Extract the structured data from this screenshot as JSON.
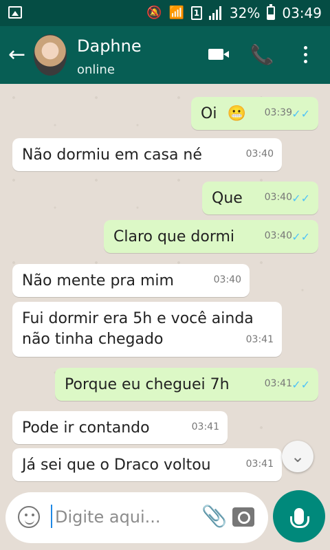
{
  "status_bar": {
    "icons": [
      "gallery-icon",
      "mute-icon",
      "wifi-icon",
      "sim-icon",
      "signal-icon"
    ],
    "sim_label": "1",
    "battery": "32%",
    "time": "03:49"
  },
  "header": {
    "contact_name": "Daphne",
    "contact_status": "online"
  },
  "messages": [
    {
      "dir": "out",
      "text": "Oi",
      "emoji": "😬",
      "time": "03:39",
      "read": true
    },
    {
      "dir": "in",
      "text": "Não dormiu em casa né",
      "time": "03:40"
    },
    {
      "dir": "out",
      "text": "Que",
      "time": "03:40",
      "read": true
    },
    {
      "dir": "out",
      "text": "Claro que dormi",
      "time": "03:40",
      "read": true
    },
    {
      "dir": "in",
      "text": "Não mente pra mim",
      "time": "03:40"
    },
    {
      "dir": "in",
      "text_lines": [
        "Fui dormir era 5h e você ainda",
        "não tinha chegado"
      ],
      "time": "03:41"
    },
    {
      "dir": "out",
      "text": "Porque eu cheguei 7h",
      "time": "03:41",
      "read": true
    },
    {
      "dir": "in",
      "text": "Pode ir contando",
      "time": "03:41"
    },
    {
      "dir": "in",
      "text": "Já sei que o Draco voltou",
      "time": "03:41"
    }
  ],
  "composer": {
    "placeholder": "Digite aqui..."
  },
  "colors": {
    "header": "#075e54",
    "status_bar": "#054d44",
    "outgoing_bubble": "#dcf8c6",
    "incoming_bubble": "#ffffff",
    "read_check": "#4fc3f7",
    "fab": "#00897b"
  }
}
